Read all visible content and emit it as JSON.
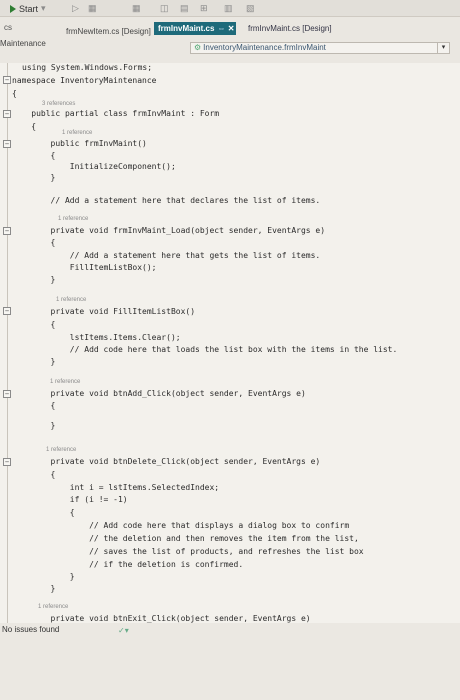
{
  "toolbar": {
    "start_label": "Start",
    "dropdown_glyph": "▾"
  },
  "tabs": {
    "left_doc": "cs",
    "newitem": "frmNewItem.cs [Design]",
    "active": "frmInvMaint.cs",
    "active_pin": "⇔",
    "active_close": "✕",
    "design": "frmInvMaint.cs [Design]"
  },
  "project_label": "Maintenance",
  "nav_dropdown": {
    "value": "InventoryMaintenance.frmInvMaint",
    "btn": "▾"
  },
  "code": {
    "l01": "using System.Windows.Forms;",
    "l02": "namespace InventoryMaintenance",
    "l03": "{",
    "r1": "3 references",
    "l04": "    public partial class frmInvMaint : Form",
    "l05": "    {",
    "r2": "1 reference",
    "l06": "        public frmInvMaint()",
    "l07": "        {",
    "l08": "            InitializeComponent();",
    "l09": "        }",
    "l10": "        // Add a statement here that declares the list of items.",
    "r3": "1 reference",
    "l11": "        private void frmInvMaint_Load(object sender, EventArgs e)",
    "l12": "        {",
    "l13": "            // Add a statement here that gets the list of items.",
    "l14": "            FillItemListBox();",
    "l15": "        }",
    "r4": "1 reference",
    "l16": "        private void FillItemListBox()",
    "l17": "        {",
    "l18": "            lstItems.Items.Clear();",
    "l19": "            // Add code here that loads the list box with the items in the list.",
    "l20": "        }",
    "r5": "1 reference",
    "l21": "        private void btnAdd_Click(object sender, EventArgs e)",
    "l22": "        {",
    "l23": "        }",
    "r6": "1 reference",
    "l24": "        private void btnDelete_Click(object sender, EventArgs e)",
    "l25": "        {",
    "l26": "            int i = lstItems.SelectedIndex;",
    "l27": "            if (i != -1)",
    "l28": "            {",
    "l29": "                // Add code here that displays a dialog box to confirm",
    "l30": "                // the deletion and then removes the item from the list,",
    "l31": "                // saves the list of products, and refreshes the list box",
    "l32": "                // if the deletion is confirmed.",
    "l33": "            }",
    "l34": "        }",
    "r7": "1 reference",
    "l35": "        private void btnExit_Click(object sender, EventArgs e)"
  },
  "fold_glyph": "−",
  "status": {
    "issues_text": "No issues found",
    "issue_icon": "✓▾"
  },
  "colors": {
    "active_tab": "#1e6a7a",
    "editor_bg": "#f3f1ec"
  }
}
